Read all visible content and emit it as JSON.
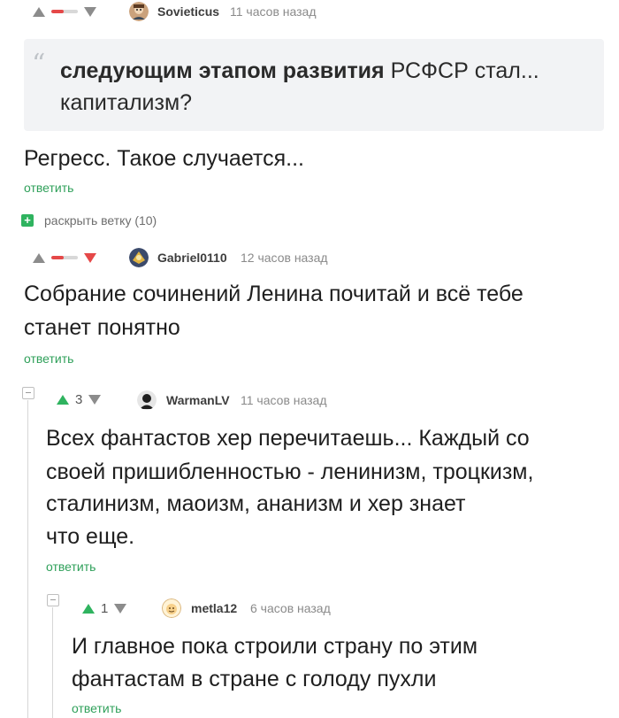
{
  "comment1": {
    "author": "Sovieticus",
    "time": "11 часов назад",
    "quote_bold": "следующим этапом развития",
    "quote_rest": " РСФСР стал... капитализм?",
    "text": "Регресс. Такое случается...",
    "reply": "ответить"
  },
  "expand_thread": "раскрыть ветку (10)",
  "comment2": {
    "author": "Gabriel0110",
    "time": "12 часов назад",
    "text_line1": "Собрание сочинений Ленина почитай и всё тебе",
    "text_line2": "станет понятно",
    "reply": "ответить"
  },
  "comment3": {
    "rating": "3",
    "author": "WarmanLV",
    "time": "11 часов назад",
    "text_line1": "Всех фантастов хер перечитаешь... Каждый со",
    "text_line2": "своей пришибленностью - ленинизм, троцкизм,",
    "text_line3": "сталинизм, маоизм, ананизм и хер знает",
    "text_line4": "что еще.",
    "reply": "ответить"
  },
  "comment4": {
    "rating": "1",
    "author": "metla12",
    "time": "6 часов назад",
    "text_line1": "И главное пока строили страну по этим",
    "text_line2": "фантастам в стране с голоду пухли",
    "reply": "ответить"
  },
  "colors": {
    "upvote_green": "#2fb35f",
    "downvote_red": "#e54848",
    "reply_green": "#2fa05a",
    "quote_bg": "#f2f3f5"
  }
}
